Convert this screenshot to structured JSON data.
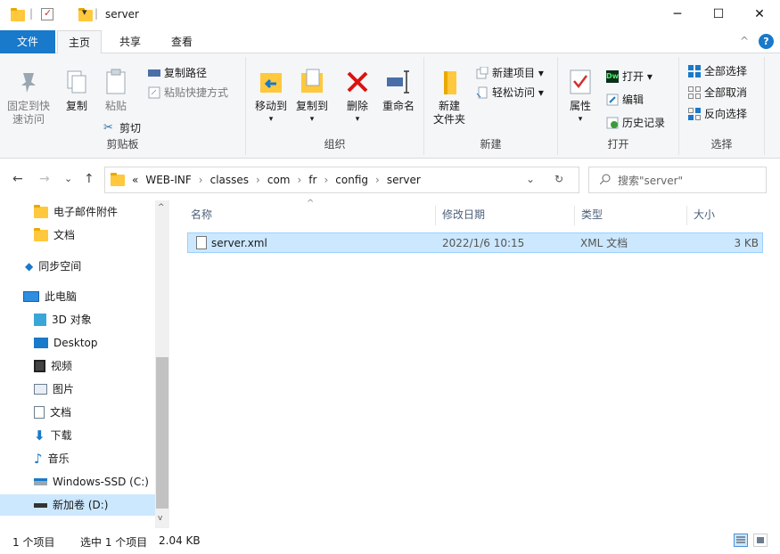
{
  "window": {
    "title": "server",
    "minimize": "─",
    "maximize": "☐",
    "close": "✕"
  },
  "tabs": {
    "file": "文件",
    "home": "主页",
    "share": "共享",
    "view": "查看",
    "collapse": "^",
    "help": "?"
  },
  "ribbon": {
    "clipboard": {
      "label": "剪贴板",
      "pin": "固定到快速访问",
      "pin_line1": "固定到快",
      "pin_line2": "速访问",
      "copy": "复制",
      "paste": "粘贴",
      "copy_path": "复制路径",
      "paste_shortcut": "粘贴快捷方式",
      "cut": "剪切"
    },
    "organize": {
      "label": "组织",
      "move_to": "移动到",
      "copy_to": "复制到",
      "delete": "删除",
      "rename": "重命名"
    },
    "new": {
      "label": "新建",
      "new_folder_line1": "新建",
      "new_folder_line2": "文件夹",
      "new_item": "新建项目 ▾",
      "easy_access": "轻松访问 ▾"
    },
    "open": {
      "label": "打开",
      "properties": "属性",
      "open": "打开 ▾",
      "edit": "编辑",
      "history": "历史记录"
    },
    "select": {
      "label": "选择",
      "select_all": "全部选择",
      "select_none": "全部取消",
      "invert": "反向选择"
    }
  },
  "address": {
    "back": "←",
    "forward": "→",
    "recent": "⌄",
    "up": "↑",
    "overflow": "«",
    "crumbs": [
      "WEB-INF",
      "classes",
      "com",
      "fr",
      "config",
      "server"
    ],
    "sep": "›",
    "dropdown": "⌄",
    "refresh": "↻",
    "search_placeholder": "搜索\"server\""
  },
  "nav": {
    "items": [
      {
        "label": "电子邮件附件"
      },
      {
        "label": "文档"
      },
      {
        "label": "同步空间"
      },
      {
        "label": "此电脑"
      },
      {
        "label": "3D 对象"
      },
      {
        "label": "Desktop"
      },
      {
        "label": "视频"
      },
      {
        "label": "图片"
      },
      {
        "label": "文档"
      },
      {
        "label": "下载"
      },
      {
        "label": "音乐"
      },
      {
        "label": "Windows-SSD (C:)"
      },
      {
        "label": "新加卷 (D:)"
      }
    ]
  },
  "filelist": {
    "headers": {
      "name": "名称",
      "date": "修改日期",
      "type": "类型",
      "size": "大小"
    },
    "rows": [
      {
        "name": "server.xml",
        "date": "2022/1/6 10:15",
        "type": "XML 文档",
        "size": "3 KB"
      }
    ]
  },
  "status": {
    "count": "1 个项目",
    "selected": "选中 1 个项目",
    "size": "2.04 KB"
  }
}
